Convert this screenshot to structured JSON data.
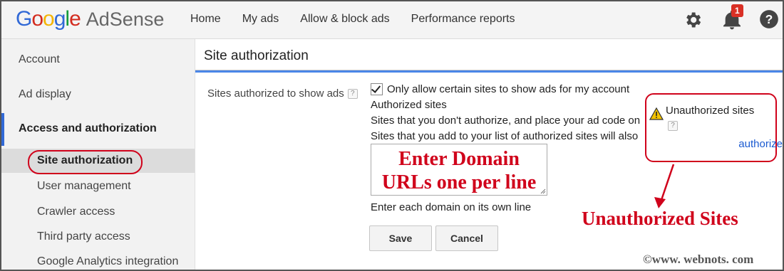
{
  "header": {
    "logo_google": [
      "G",
      "o",
      "o",
      "g",
      "l",
      "e"
    ],
    "product": "AdSense",
    "nav": [
      "Home",
      "My ads",
      "Allow & block ads",
      "Performance reports"
    ],
    "notifications_count": "1",
    "icons": [
      "gear-icon",
      "bell-icon",
      "help-icon"
    ]
  },
  "sidebar": {
    "account": "Account",
    "ad_display": "Ad display",
    "access": "Access and authorization",
    "site_authorization": "Site authorization",
    "subitems": [
      "User management",
      "Crawler access",
      "Third party access",
      "Google Analytics integration"
    ]
  },
  "main": {
    "title": "Site authorization",
    "field_label": "Sites authorized to show ads",
    "help_mark": "?",
    "checkbox_label": "Only allow certain sites to show ads for my account",
    "authorized_heading": "Authorized sites",
    "info_line_1": "Sites that you don't authorize, and place your ad code on",
    "info_line_2": "Sites that you add to your list of authorized sites will also",
    "textarea_annotation": "Enter Domain URLs one per line",
    "textarea_hint": "Enter each domain on its own line",
    "save_label": "Save",
    "cancel_label": "Cancel"
  },
  "unauthorized": {
    "title": "Unauthorized sites",
    "help_mark": "?",
    "link": "authorize"
  },
  "annotations": {
    "callout": "Unauthorized Sites",
    "copyright": "©www. webnots. com",
    "accent_color": "#d0021b"
  }
}
